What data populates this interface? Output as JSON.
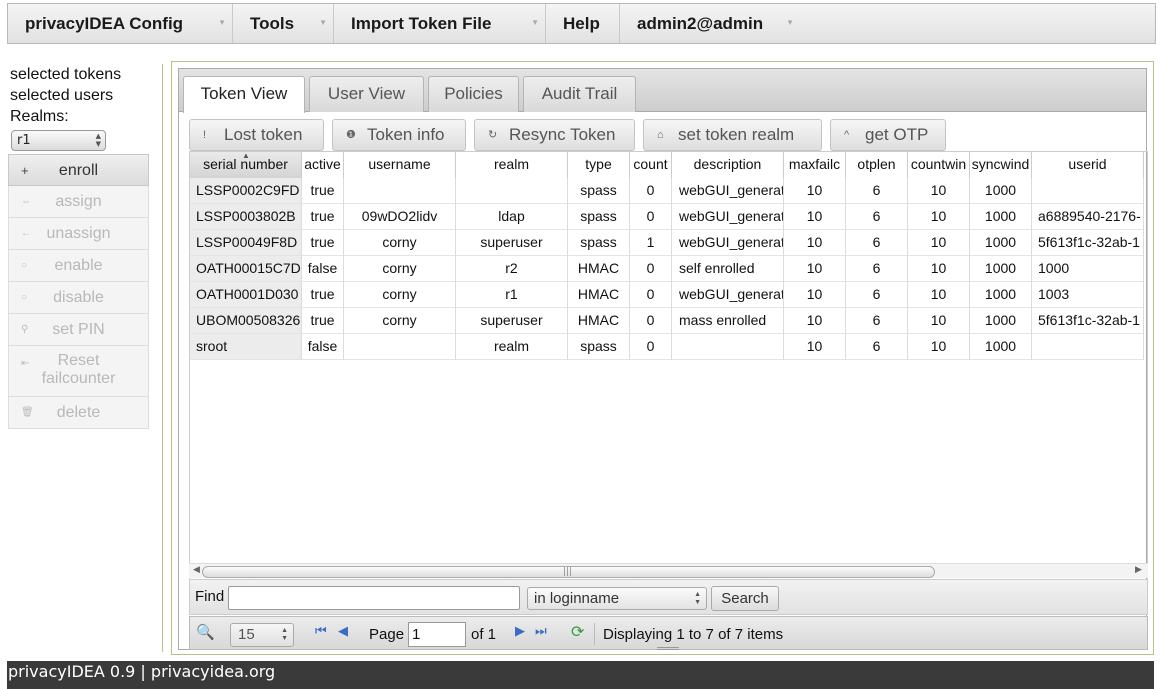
{
  "menu": {
    "config": "privacyIDEA Config",
    "tools": "Tools",
    "import": "Import Token File",
    "help": "Help",
    "user": "admin2@admin"
  },
  "left": {
    "selected_tokens": "selected tokens",
    "selected_users": "selected users",
    "realms_label": "Realms:",
    "realm_value": "r1",
    "actions": {
      "enroll": "enroll",
      "assign": "assign",
      "unassign": "unassign",
      "enable": "enable",
      "disable": "disable",
      "setpin": "set PIN",
      "reset_line1": "Reset",
      "reset_line2": "failcounter",
      "delete": "delete"
    }
  },
  "tabs": {
    "token_view": "Token View",
    "user_view": "User View",
    "policies": "Policies",
    "audit_trail": "Audit Trail"
  },
  "toolbar": {
    "lost_token": "Lost token",
    "token_info": "Token info",
    "resync": "Resync Token",
    "set_realm": "set token realm",
    "get_otp": "get OTP"
  },
  "grid": {
    "headers": {
      "serial": "serial number",
      "active": "active",
      "username": "username",
      "realm": "realm",
      "type": "type",
      "count": "count",
      "description": "description",
      "maxfail": "maxfailc",
      "otplen": "otplen",
      "countwin": "countwin",
      "syncwin": "syncwind",
      "userid": "userid"
    },
    "rows": [
      {
        "serial": "LSSP0002C9FD",
        "active": "true",
        "username": "",
        "realm": "",
        "type": "spass",
        "count": "0",
        "description": "webGUI_generat",
        "maxfail": "10",
        "otplen": "6",
        "countwin": "10",
        "syncwin": "1000",
        "userid": ""
      },
      {
        "serial": "LSSP0003802B",
        "active": "true",
        "username": "09wDO2lidv",
        "realm": "ldap",
        "type": "spass",
        "count": "0",
        "description": "webGUI_generat",
        "maxfail": "10",
        "otplen": "6",
        "countwin": "10",
        "syncwin": "1000",
        "userid": "a6889540-2176-"
      },
      {
        "serial": "LSSP00049F8D",
        "active": "true",
        "username": "corny",
        "realm": "superuser",
        "type": "spass",
        "count": "1",
        "description": "webGUI_generat",
        "maxfail": "10",
        "otplen": "6",
        "countwin": "10",
        "syncwin": "1000",
        "userid": "5f613f1c-32ab-1"
      },
      {
        "serial": "OATH00015C7D",
        "active": "false",
        "username": "corny",
        "realm": "r2",
        "type": "HMAC",
        "count": "0",
        "description": "self enrolled",
        "maxfail": "10",
        "otplen": "6",
        "countwin": "10",
        "syncwin": "1000",
        "userid": "1000"
      },
      {
        "serial": "OATH0001D030",
        "active": "true",
        "username": "corny",
        "realm": "r1",
        "type": "HMAC",
        "count": "0",
        "description": "webGUI_generat",
        "maxfail": "10",
        "otplen": "6",
        "countwin": "10",
        "syncwin": "1000",
        "userid": "1003"
      },
      {
        "serial": "UBOM00508326",
        "active": "true",
        "username": "corny",
        "realm": "superuser",
        "type": "HMAC",
        "count": "0",
        "description": "mass enrolled",
        "maxfail": "10",
        "otplen": "6",
        "countwin": "10",
        "syncwin": "1000",
        "userid": "5f613f1c-32ab-1"
      },
      {
        "serial": "sroot",
        "active": "false",
        "username": "",
        "realm": "realm",
        "type": "spass",
        "count": "0",
        "description": "",
        "maxfail": "10",
        "otplen": "6",
        "countwin": "10",
        "syncwin": "1000",
        "userid": ""
      }
    ]
  },
  "search": {
    "find_label": "Find",
    "find_value": "",
    "field": "in loginname",
    "button": "Search"
  },
  "pager": {
    "page_size": "15",
    "page_label": "Page",
    "page_value": "1",
    "of_label": "of 1",
    "info": "Displaying 1 to 7 of 7 items"
  },
  "footer": {
    "text": "privacyIDEA 0.9 | privacyidea.org"
  }
}
